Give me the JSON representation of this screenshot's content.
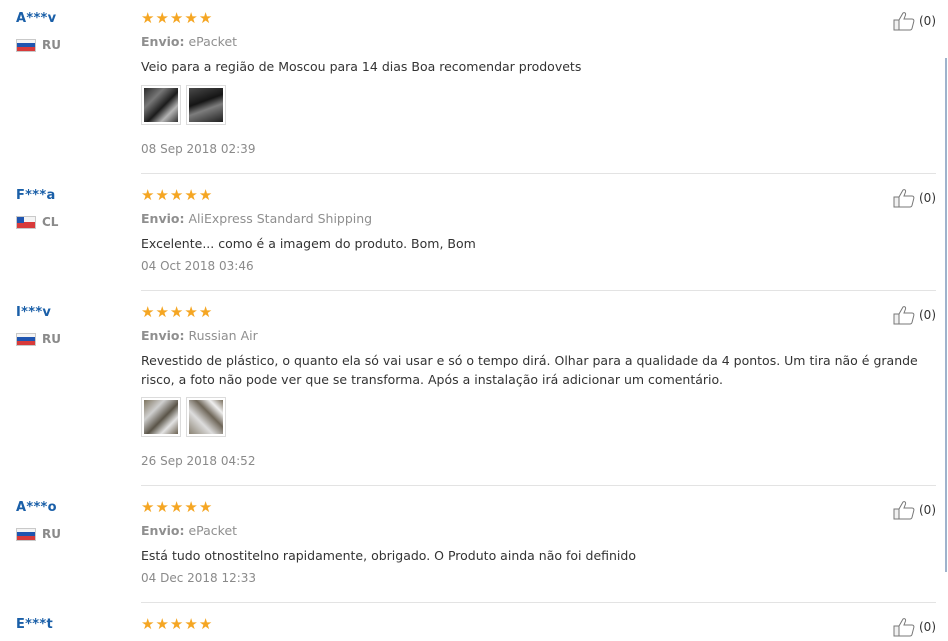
{
  "reviews": [
    {
      "user": "A***v",
      "country": "RU",
      "flag": "ru",
      "rating": 5,
      "shipping_label": "Envio:",
      "shipping": "ePacket",
      "text": "Veio para a região de Moscou para 14 dias Boa recomendar prodovets",
      "photos": [
        "img-dark1",
        "img-dark2"
      ],
      "date": "08 Sep 2018 02:39",
      "helpful": "(0)"
    },
    {
      "user": "F***a",
      "country": "CL",
      "flag": "cl",
      "rating": 5,
      "shipping_label": "Envio:",
      "shipping": "AliExpress Standard Shipping",
      "text": "Excelente... como é a imagem do produto. Bom, Bom",
      "photos": [],
      "date": "04 Oct 2018 03:46",
      "helpful": "(0)"
    },
    {
      "user": "I***v",
      "country": "RU",
      "flag": "ru",
      "rating": 5,
      "shipping_label": "Envio:",
      "shipping": "Russian Air",
      "text": "Revestido de plástico, o quanto ela só vai usar e só o tempo dirá. Olhar para a qualidade da 4 pontos. Um tira não é grande risco, a foto não pode ver que se transforma. Após a instalação irá adicionar um comentário.",
      "photos": [
        "img-silver1",
        "img-silver2"
      ],
      "date": "26 Sep 2018 04:52",
      "helpful": "(0)"
    },
    {
      "user": "A***o",
      "country": "RU",
      "flag": "ru",
      "rating": 5,
      "shipping_label": "Envio:",
      "shipping": "ePacket",
      "text": "Está tudo otnostitelno rapidamente, obrigado. O Produto ainda não foi definido",
      "photos": [],
      "date": "04 Dec 2018 12:33",
      "helpful": "(0)"
    },
    {
      "user": "E***t",
      "country": "",
      "flag": "",
      "rating": 5,
      "shipping_label": "",
      "shipping": "",
      "text": "",
      "photos": [],
      "date": "",
      "helpful": "(0)"
    }
  ],
  "colors": {
    "star": "#f5a623",
    "username": "#1a5fa8"
  }
}
